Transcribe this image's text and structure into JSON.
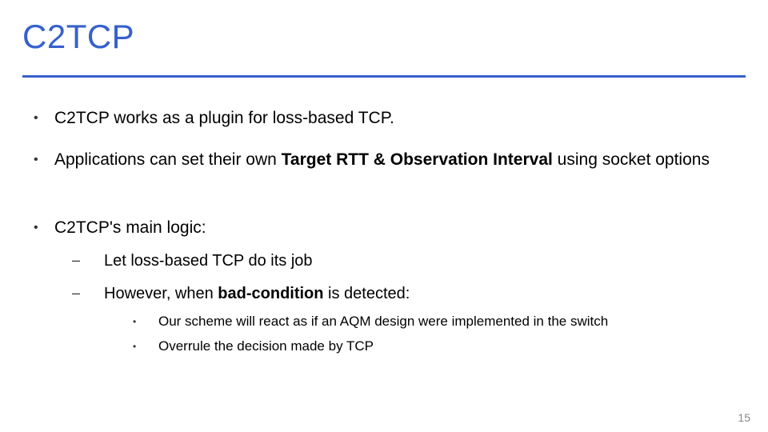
{
  "title": "C2TCP",
  "bullets": {
    "b1": "C2TCP works as a plugin for loss-based TCP.",
    "b2_pre": "Applications can set their own ",
    "b2_bold": "Target RTT & Observation Interval",
    "b2_post": " using socket options",
    "b3": "C2TCP's main logic:",
    "b3a": "Let loss-based TCP do its job",
    "b3b_pre": "However, when ",
    "b3b_bold": "bad-condition",
    "b3b_post": " is detected:",
    "b3b_i": "Our scheme will react as if an AQM design were implemented in the switch",
    "b3b_ii": "Overrule the decision made by TCP"
  },
  "page_number": "15"
}
